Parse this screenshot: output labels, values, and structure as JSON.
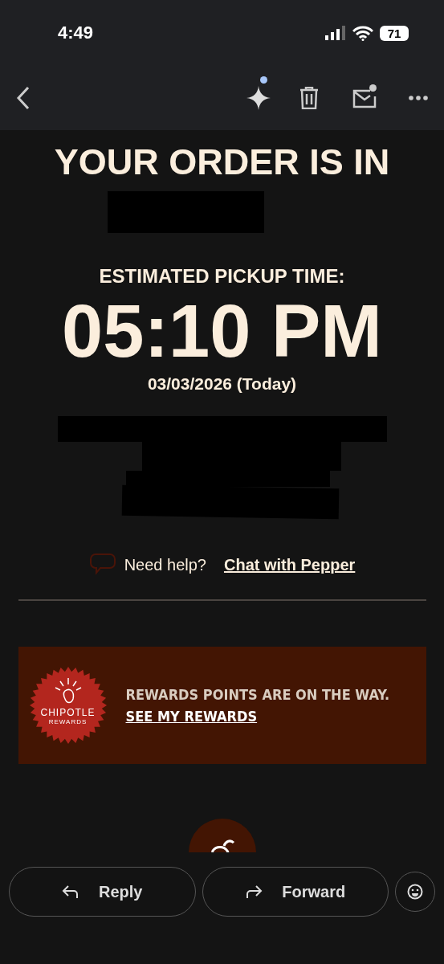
{
  "status_bar": {
    "time": "4:49",
    "battery": "71"
  },
  "toolbar": {
    "assistant_badge": true,
    "mail_badge": true
  },
  "email": {
    "headline": "YOUR ORDER IS IN",
    "pickup_label": "ESTIMATED PICKUP TIME:",
    "pickup_time": "05:10 PM",
    "pickup_date": "03/03/2026 (Today)",
    "help": {
      "text": "Need help?",
      "link": "Chat with Pepper"
    },
    "rewards": {
      "badge_title": "CHIPOTLE",
      "badge_subtitle": "REWARDS",
      "message": "REWARDS POINTS ARE ON THE WAY.",
      "link": "SEE MY REWARDS"
    }
  },
  "actions": [
    "Reply",
    "Forward"
  ]
}
